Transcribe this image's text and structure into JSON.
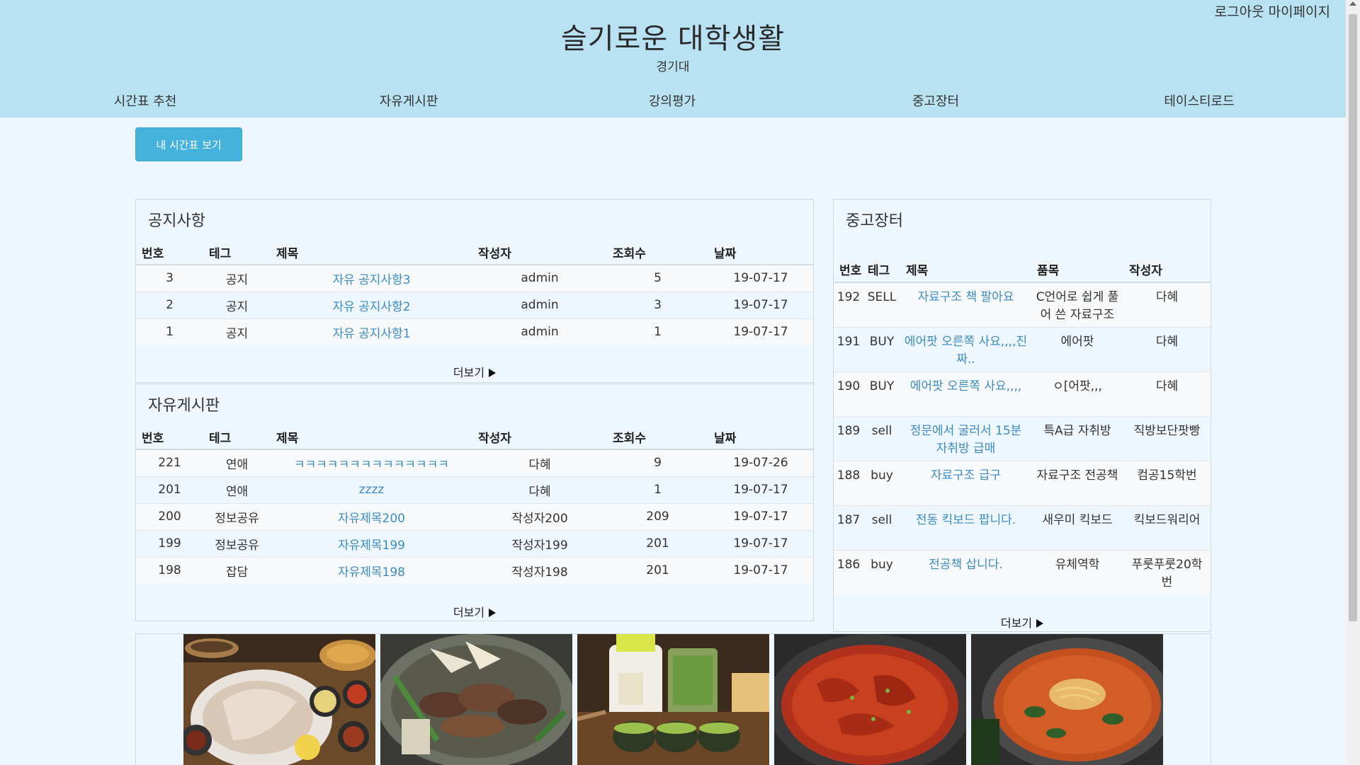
{
  "header": {
    "logout": "로그아웃",
    "mypage": "마이페이지",
    "title": "슬기로운 대학생활",
    "subtitle": "경기대",
    "nav": [
      "시간표 추천",
      "자유게시판",
      "강의평가",
      "중고장터",
      "테이스티로드"
    ]
  },
  "my_timetable_button": "내 시간표 보기",
  "notice": {
    "title": "공지사항",
    "columns": [
      "번호",
      "테그",
      "제목",
      "작성자",
      "조회수",
      "날짜"
    ],
    "rows": [
      {
        "no": "3",
        "tag": "공지",
        "title": "자유 공지사항3",
        "author": "admin",
        "views": "5",
        "date": "19-07-17"
      },
      {
        "no": "2",
        "tag": "공지",
        "title": "자유 공지사항2",
        "author": "admin",
        "views": "3",
        "date": "19-07-17"
      },
      {
        "no": "1",
        "tag": "공지",
        "title": "자유 공지사항1",
        "author": "admin",
        "views": "1",
        "date": "19-07-17"
      }
    ],
    "more": "더보기"
  },
  "free_board": {
    "title": "자유게시판",
    "columns": [
      "번호",
      "테그",
      "제목",
      "작성자",
      "조회수",
      "날짜"
    ],
    "rows": [
      {
        "no": "221",
        "tag": "연애",
        "title": "ㅋㅋㅋㅋㅋㅋㅋㅋㅋㅋㅋㅋㅋㅋ",
        "author": "다혜",
        "views": "9",
        "date": "19-07-26"
      },
      {
        "no": "201",
        "tag": "연애",
        "title": "zzzz",
        "author": "다혜",
        "views": "1",
        "date": "19-07-17"
      },
      {
        "no": "200",
        "tag": "정보공유",
        "title": "자유제목200",
        "author": "작성자200",
        "views": "209",
        "date": "19-07-17"
      },
      {
        "no": "199",
        "tag": "정보공유",
        "title": "자유제목199",
        "author": "작성자199",
        "views": "201",
        "date": "19-07-17"
      },
      {
        "no": "198",
        "tag": "잡담",
        "title": "자유제목198",
        "author": "작성자198",
        "views": "201",
        "date": "19-07-17"
      }
    ],
    "more": "더보기"
  },
  "market": {
    "title": "중고장터",
    "columns": [
      "번호",
      "테그",
      "제목",
      "품목",
      "작성자"
    ],
    "rows": [
      {
        "no": "192",
        "tag": "SELL",
        "title": "자료구조 책 팔아요",
        "item": "C언어로 쉽게 풀어 쓴 자료구조",
        "author": "다혜"
      },
      {
        "no": "191",
        "tag": "BUY",
        "title": "에어팟 오른쪽 사요,,,,진짜..",
        "item": "에어팟",
        "author": "다혜"
      },
      {
        "no": "190",
        "tag": "BUY",
        "title": "에어팟 오른쪽 사요,,,,",
        "item": "ㅇ[어팟,,,",
        "author": "다혜"
      },
      {
        "no": "189",
        "tag": "sell",
        "title": "정문에서 굴러서 15분 자취방 급매",
        "item": "특A급 자취방",
        "author": "직방보단팟빵"
      },
      {
        "no": "188",
        "tag": "buy",
        "title": "자료구조 급구",
        "item": "자료구조 전공책",
        "author": "컴공15학번"
      },
      {
        "no": "187",
        "tag": "sell",
        "title": "전동 킥보드 팝니다.",
        "item": "새우미 킥보드",
        "author": "킥보드워리어"
      },
      {
        "no": "186",
        "tag": "buy",
        "title": "전공책 삽니다.",
        "item": "유체역학",
        "author": "푸룻푸룻20학번"
      }
    ],
    "more": "더보기"
  },
  "gallery": {
    "photos": [
      "grilled-fish-platter-photo",
      "grilled-pork-pan-photo",
      "matcha-dessert-photo",
      "spicy-chicken-feet-photo",
      "ramen-stew-photo"
    ]
  }
}
